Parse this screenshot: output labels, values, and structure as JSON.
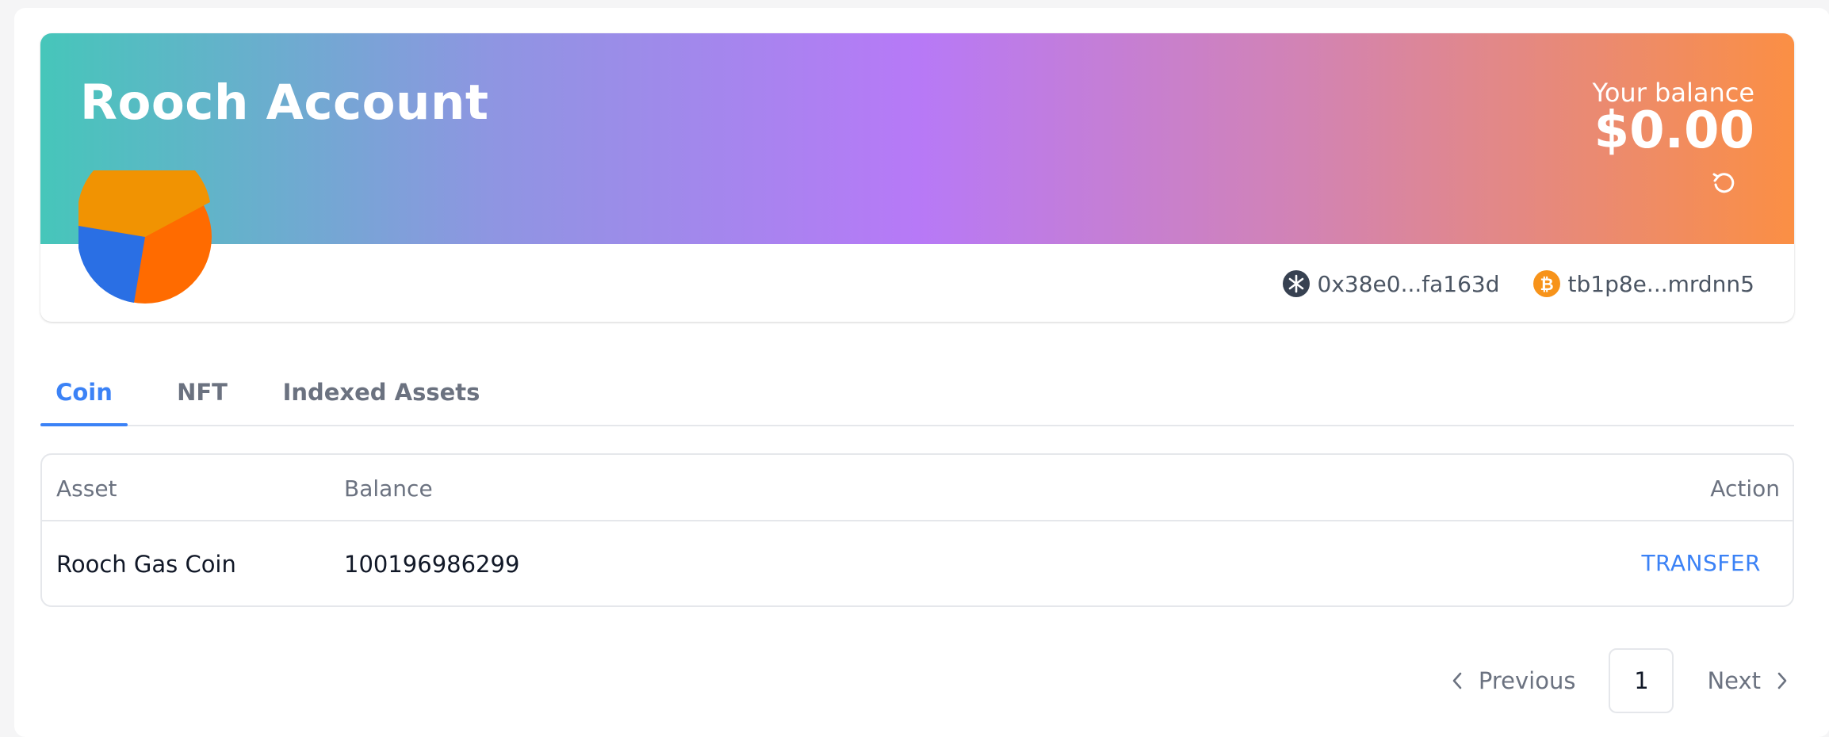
{
  "header": {
    "title": "Rooch Account",
    "balance_label": "Your balance",
    "balance_value": "$0.00"
  },
  "addresses": [
    {
      "network": "rooch",
      "icon": "rooch-logo-icon",
      "text": "0x38e0...fa163d"
    },
    {
      "network": "bitcoin",
      "icon": "bitcoin-icon",
      "text": "tb1p8e...mrdnn5"
    }
  ],
  "tabs": [
    {
      "label": "Coin",
      "active": true
    },
    {
      "label": "NFT",
      "active": false
    },
    {
      "label": "Indexed Assets",
      "active": false
    }
  ],
  "table": {
    "columns": [
      "Asset",
      "Balance",
      "Action"
    ],
    "rows": [
      {
        "asset": "Rooch Gas Coin",
        "balance": "100196986299",
        "action": "TRANSFER"
      }
    ]
  },
  "pagination": {
    "previous": "Previous",
    "current_page": "1",
    "next": "Next"
  },
  "colors": {
    "accent": "#3b82f6",
    "gradient_start": "#46c6ba",
    "gradient_mid": "#b779f7",
    "gradient_end": "#fb8f44"
  }
}
